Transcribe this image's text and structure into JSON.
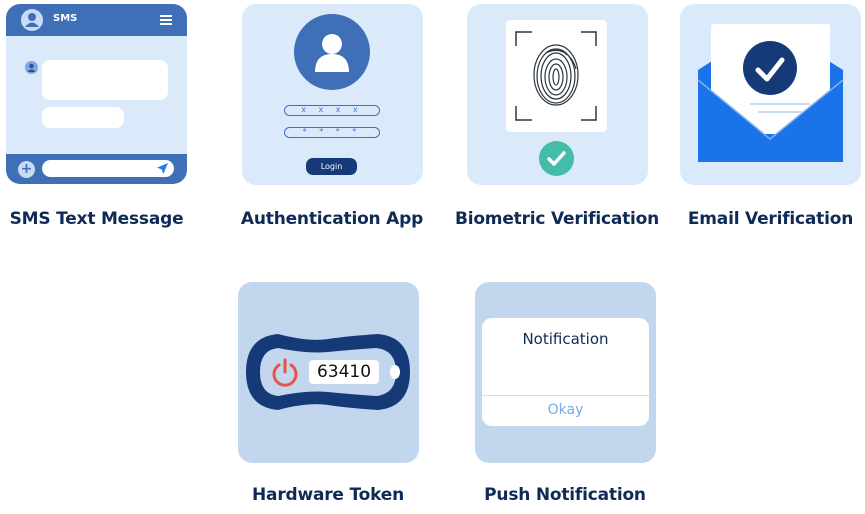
{
  "methods": [
    {
      "id": "sms",
      "label": "SMS Text Message",
      "illustration": {
        "header_title": "SMS",
        "icons": [
          "user-avatar-icon",
          "hamburger-menu-icon",
          "plus-icon",
          "send-icon"
        ]
      }
    },
    {
      "id": "auth",
      "label": "Authentication App",
      "illustration": {
        "username_field": "x x x x",
        "password_field": "* * * *",
        "login_button": "Login",
        "icons": [
          "user-avatar-icon"
        ]
      }
    },
    {
      "id": "biometric",
      "label": "Biometric Verification",
      "illustration": {
        "icons": [
          "fingerprint-icon",
          "scan-frame-icon",
          "check-circle-icon"
        ]
      }
    },
    {
      "id": "email",
      "label": "Email Verification",
      "illustration": {
        "icons": [
          "envelope-icon",
          "check-circle-icon"
        ]
      }
    },
    {
      "id": "hardware",
      "label": "Hardware Token",
      "illustration": {
        "code": "63410",
        "icons": [
          "power-icon"
        ]
      }
    },
    {
      "id": "push",
      "label": "Push Notification",
      "illustration": {
        "title": "Notification",
        "button": "Okay"
      }
    }
  ],
  "colors": {
    "card_light": "#dbeafb",
    "card_mid": "#c2d6ee",
    "primary_blue": "#3f70b7",
    "navy": "#163a78",
    "label_text": "#0f2b55",
    "teal_check": "#44bca9",
    "envelope_blue": "#1a73e8",
    "power_red": "#e8544a"
  }
}
